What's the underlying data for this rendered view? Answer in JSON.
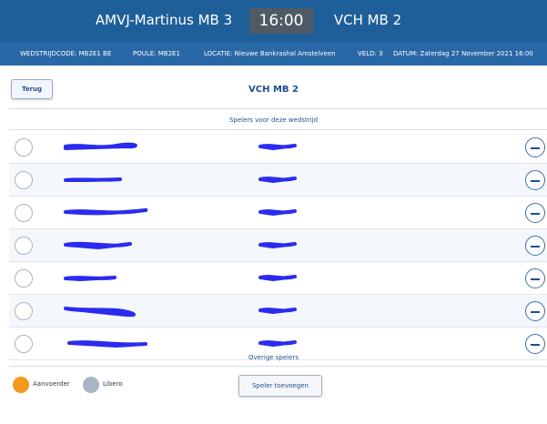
{
  "match": {
    "home_team": "AMVJ-Martinus MB 3",
    "time": "16:00",
    "away_team": "VCH MB 2"
  },
  "info": {
    "code": "WEDSTRIJDCODE: MB2E1 BE",
    "poule": "POULE: MB2E1",
    "location": "LOCATIE: Nieuwe Bankrashal Amstelveen",
    "field": "VELD: 3",
    "date": "DATUM: Zaterdag 27 November 2021 16:00"
  },
  "page": {
    "back_label": "Terug",
    "team_title": "VCH MB 2",
    "players_section": "Spelers voor deze wedstrijd",
    "other_section": "Overige spelers"
  },
  "players": [
    {
      "name": "",
      "number": "",
      "selected": false
    },
    {
      "name": "",
      "number": "",
      "selected": false
    },
    {
      "name": "",
      "number": "",
      "selected": false
    },
    {
      "name": "",
      "number": "",
      "selected": false
    },
    {
      "name": "",
      "number": "",
      "selected": false
    },
    {
      "name": "",
      "number": "",
      "selected": false
    },
    {
      "name": "",
      "number": "",
      "selected": false
    }
  ],
  "legend": {
    "captain_label": "Aanvoerder",
    "captain_color": "#f29a1c",
    "libero_label": "Libero",
    "libero_color": "#a9b5c4"
  },
  "actions": {
    "add_player_label": "Speler toevoegen"
  },
  "colors": {
    "header": "#1f5f99",
    "infobar": "#2968a6",
    "accent": "#1f4f8f",
    "redaction": "#2b2bf0"
  }
}
